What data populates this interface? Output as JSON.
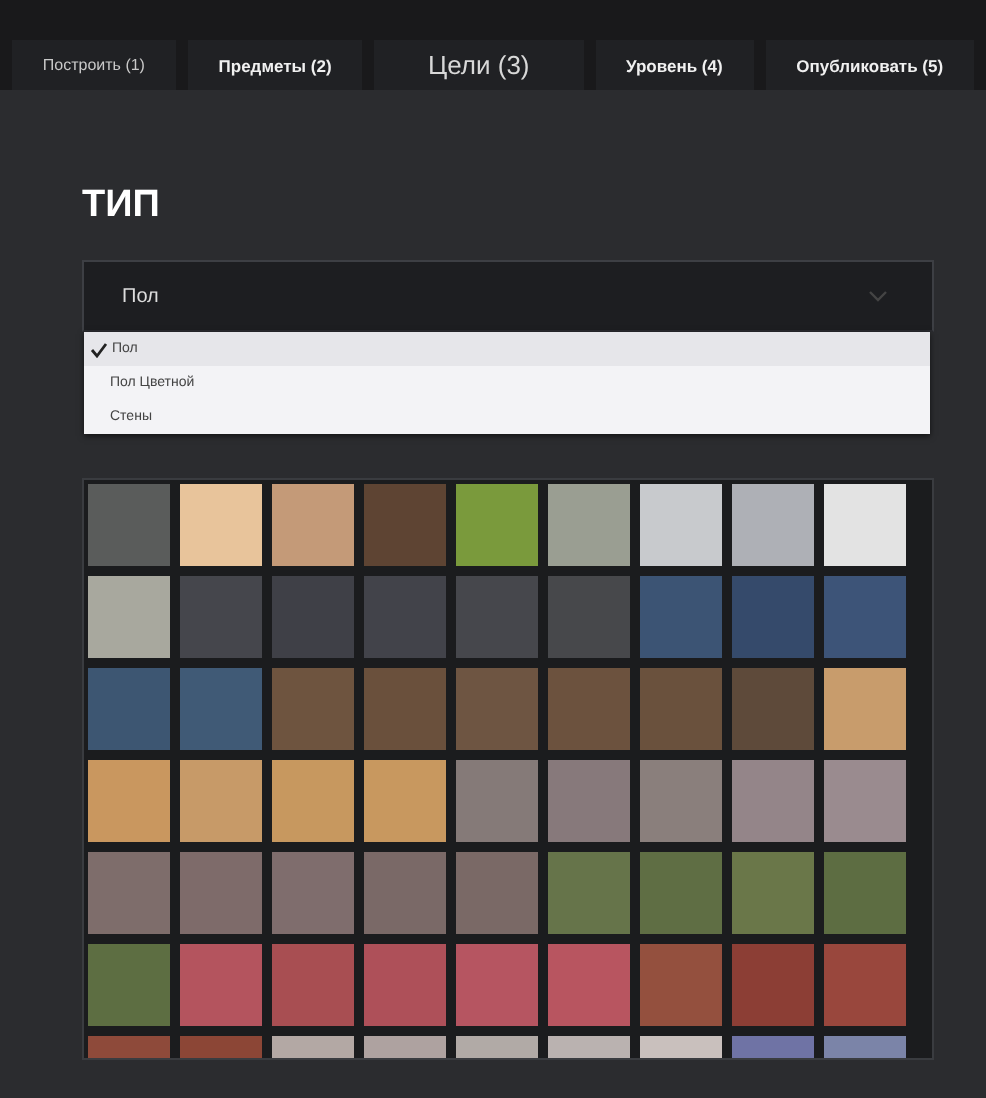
{
  "tabs": [
    {
      "label": "Построить (1)",
      "selected": false
    },
    {
      "label": "Предметы (2)",
      "selected": false
    },
    {
      "label": "Цели (3)",
      "selected": true
    },
    {
      "label": "Уровень (4)",
      "selected": false
    },
    {
      "label": "Опубликовать (5)",
      "selected": false
    }
  ],
  "type_section": {
    "heading": "ТИП",
    "select": {
      "value": "Пол",
      "expanded": true,
      "options": [
        {
          "label": "Пол",
          "selected": true
        },
        {
          "label": "Пол Цветной",
          "selected": false
        },
        {
          "label": "Стены",
          "selected": false
        }
      ]
    }
  },
  "assets": [
    {
      "color": "#5a5c5b"
    },
    {
      "color": "#e8c49b"
    },
    {
      "color": "#c49a78"
    },
    {
      "color": "#5e4433"
    },
    {
      "color": "#7a9a3c"
    },
    {
      "color": "#9a9e92"
    },
    {
      "color": "#c8cacd"
    },
    {
      "color": "#aeb0b6"
    },
    {
      "color": "#e3e3e3"
    },
    {
      "color": "#a8a89e"
    },
    {
      "color": "#45464c"
    },
    {
      "color": "#3f4047"
    },
    {
      "color": "#42434a"
    },
    {
      "color": "#46474c"
    },
    {
      "color": "#47484b"
    },
    {
      "color": "#3c5474"
    },
    {
      "color": "#354a6b"
    },
    {
      "color": "#3d5478"
    },
    {
      "color": "#3d5672"
    },
    {
      "color": "#405a76"
    },
    {
      "color": "#6e543f"
    },
    {
      "color": "#6a503c"
    },
    {
      "color": "#6e5542"
    },
    {
      "color": "#6c523e"
    },
    {
      "color": "#6a513d"
    },
    {
      "color": "#5e4a3a"
    },
    {
      "color": "#c89c6c"
    },
    {
      "color": "#c9975f"
    },
    {
      "color": "#c79a68"
    },
    {
      "color": "#c7985f"
    },
    {
      "color": "#c8985f"
    },
    {
      "color": "#857a78"
    },
    {
      "color": "#87797b"
    },
    {
      "color": "#8a7f7c"
    },
    {
      "color": "#948589"
    },
    {
      "color": "#9a8b8f"
    },
    {
      "color": "#7e6d6b"
    },
    {
      "color": "#7e6b6a"
    },
    {
      "color": "#7f6d6d"
    },
    {
      "color": "#7a6967"
    },
    {
      "color": "#7a6966"
    },
    {
      "color": "#66744a"
    },
    {
      "color": "#5f6e44"
    },
    {
      "color": "#6a7749"
    },
    {
      "color": "#5d6d42"
    },
    {
      "color": "#5d6e42"
    },
    {
      "color": "#b4545e"
    },
    {
      "color": "#a84e52"
    },
    {
      "color": "#ae5059"
    },
    {
      "color": "#b65561"
    },
    {
      "color": "#b85560"
    },
    {
      "color": "#94503e"
    },
    {
      "color": "#8c3e35"
    },
    {
      "color": "#99473d"
    },
    {
      "color": "#8e4a3a"
    },
    {
      "color": "#8c4636"
    },
    {
      "color": "#b3a8a4"
    },
    {
      "color": "#aea2a0"
    },
    {
      "color": "#b1aaa6"
    },
    {
      "color": "#bab2b0"
    },
    {
      "color": "#c9c0bd"
    },
    {
      "color": "#6f73a5"
    },
    {
      "color": "#7b84a8"
    }
  ]
}
